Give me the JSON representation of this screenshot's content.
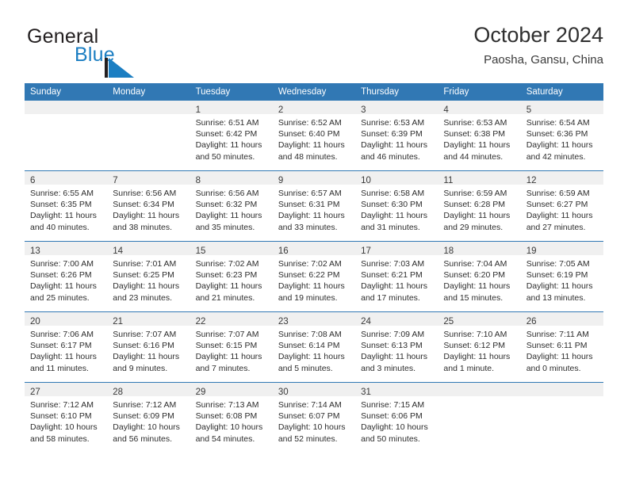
{
  "brand": {
    "name_part1": "General",
    "name_part2": "Blue",
    "mark_icon": "triangle-logo-icon",
    "accent_color": "#1b7ec2",
    "dark_color": "#231f20"
  },
  "header": {
    "title": "October 2024",
    "subtitle": "Paosha, Gansu, China"
  },
  "theme": {
    "header_bg": "#3178b4",
    "daynum_bg": "#f0f0f0",
    "row_divider": "#3178b4"
  },
  "weekday_headers": [
    "Sunday",
    "Monday",
    "Tuesday",
    "Wednesday",
    "Thursday",
    "Friday",
    "Saturday"
  ],
  "weeks": [
    [
      {
        "day": "",
        "sunrise": "",
        "sunset": "",
        "daylight_line1": "",
        "daylight_line2": "",
        "empty": true
      },
      {
        "day": "",
        "sunrise": "",
        "sunset": "",
        "daylight_line1": "",
        "daylight_line2": "",
        "empty": true
      },
      {
        "day": "1",
        "sunrise": "Sunrise: 6:51 AM",
        "sunset": "Sunset: 6:42 PM",
        "daylight_line1": "Daylight: 11 hours",
        "daylight_line2": "and 50 minutes."
      },
      {
        "day": "2",
        "sunrise": "Sunrise: 6:52 AM",
        "sunset": "Sunset: 6:40 PM",
        "daylight_line1": "Daylight: 11 hours",
        "daylight_line2": "and 48 minutes."
      },
      {
        "day": "3",
        "sunrise": "Sunrise: 6:53 AM",
        "sunset": "Sunset: 6:39 PM",
        "daylight_line1": "Daylight: 11 hours",
        "daylight_line2": "and 46 minutes."
      },
      {
        "day": "4",
        "sunrise": "Sunrise: 6:53 AM",
        "sunset": "Sunset: 6:38 PM",
        "daylight_line1": "Daylight: 11 hours",
        "daylight_line2": "and 44 minutes."
      },
      {
        "day": "5",
        "sunrise": "Sunrise: 6:54 AM",
        "sunset": "Sunset: 6:36 PM",
        "daylight_line1": "Daylight: 11 hours",
        "daylight_line2": "and 42 minutes."
      }
    ],
    [
      {
        "day": "6",
        "sunrise": "Sunrise: 6:55 AM",
        "sunset": "Sunset: 6:35 PM",
        "daylight_line1": "Daylight: 11 hours",
        "daylight_line2": "and 40 minutes."
      },
      {
        "day": "7",
        "sunrise": "Sunrise: 6:56 AM",
        "sunset": "Sunset: 6:34 PM",
        "daylight_line1": "Daylight: 11 hours",
        "daylight_line2": "and 38 minutes."
      },
      {
        "day": "8",
        "sunrise": "Sunrise: 6:56 AM",
        "sunset": "Sunset: 6:32 PM",
        "daylight_line1": "Daylight: 11 hours",
        "daylight_line2": "and 35 minutes."
      },
      {
        "day": "9",
        "sunrise": "Sunrise: 6:57 AM",
        "sunset": "Sunset: 6:31 PM",
        "daylight_line1": "Daylight: 11 hours",
        "daylight_line2": "and 33 minutes."
      },
      {
        "day": "10",
        "sunrise": "Sunrise: 6:58 AM",
        "sunset": "Sunset: 6:30 PM",
        "daylight_line1": "Daylight: 11 hours",
        "daylight_line2": "and 31 minutes."
      },
      {
        "day": "11",
        "sunrise": "Sunrise: 6:59 AM",
        "sunset": "Sunset: 6:28 PM",
        "daylight_line1": "Daylight: 11 hours",
        "daylight_line2": "and 29 minutes."
      },
      {
        "day": "12",
        "sunrise": "Sunrise: 6:59 AM",
        "sunset": "Sunset: 6:27 PM",
        "daylight_line1": "Daylight: 11 hours",
        "daylight_line2": "and 27 minutes."
      }
    ],
    [
      {
        "day": "13",
        "sunrise": "Sunrise: 7:00 AM",
        "sunset": "Sunset: 6:26 PM",
        "daylight_line1": "Daylight: 11 hours",
        "daylight_line2": "and 25 minutes."
      },
      {
        "day": "14",
        "sunrise": "Sunrise: 7:01 AM",
        "sunset": "Sunset: 6:25 PM",
        "daylight_line1": "Daylight: 11 hours",
        "daylight_line2": "and 23 minutes."
      },
      {
        "day": "15",
        "sunrise": "Sunrise: 7:02 AM",
        "sunset": "Sunset: 6:23 PM",
        "daylight_line1": "Daylight: 11 hours",
        "daylight_line2": "and 21 minutes."
      },
      {
        "day": "16",
        "sunrise": "Sunrise: 7:02 AM",
        "sunset": "Sunset: 6:22 PM",
        "daylight_line1": "Daylight: 11 hours",
        "daylight_line2": "and 19 minutes."
      },
      {
        "day": "17",
        "sunrise": "Sunrise: 7:03 AM",
        "sunset": "Sunset: 6:21 PM",
        "daylight_line1": "Daylight: 11 hours",
        "daylight_line2": "and 17 minutes."
      },
      {
        "day": "18",
        "sunrise": "Sunrise: 7:04 AM",
        "sunset": "Sunset: 6:20 PM",
        "daylight_line1": "Daylight: 11 hours",
        "daylight_line2": "and 15 minutes."
      },
      {
        "day": "19",
        "sunrise": "Sunrise: 7:05 AM",
        "sunset": "Sunset: 6:19 PM",
        "daylight_line1": "Daylight: 11 hours",
        "daylight_line2": "and 13 minutes."
      }
    ],
    [
      {
        "day": "20",
        "sunrise": "Sunrise: 7:06 AM",
        "sunset": "Sunset: 6:17 PM",
        "daylight_line1": "Daylight: 11 hours",
        "daylight_line2": "and 11 minutes."
      },
      {
        "day": "21",
        "sunrise": "Sunrise: 7:07 AM",
        "sunset": "Sunset: 6:16 PM",
        "daylight_line1": "Daylight: 11 hours",
        "daylight_line2": "and 9 minutes."
      },
      {
        "day": "22",
        "sunrise": "Sunrise: 7:07 AM",
        "sunset": "Sunset: 6:15 PM",
        "daylight_line1": "Daylight: 11 hours",
        "daylight_line2": "and 7 minutes."
      },
      {
        "day": "23",
        "sunrise": "Sunrise: 7:08 AM",
        "sunset": "Sunset: 6:14 PM",
        "daylight_line1": "Daylight: 11 hours",
        "daylight_line2": "and 5 minutes."
      },
      {
        "day": "24",
        "sunrise": "Sunrise: 7:09 AM",
        "sunset": "Sunset: 6:13 PM",
        "daylight_line1": "Daylight: 11 hours",
        "daylight_line2": "and 3 minutes."
      },
      {
        "day": "25",
        "sunrise": "Sunrise: 7:10 AM",
        "sunset": "Sunset: 6:12 PM",
        "daylight_line1": "Daylight: 11 hours",
        "daylight_line2": "and 1 minute."
      },
      {
        "day": "26",
        "sunrise": "Sunrise: 7:11 AM",
        "sunset": "Sunset: 6:11 PM",
        "daylight_line1": "Daylight: 11 hours",
        "daylight_line2": "and 0 minutes."
      }
    ],
    [
      {
        "day": "27",
        "sunrise": "Sunrise: 7:12 AM",
        "sunset": "Sunset: 6:10 PM",
        "daylight_line1": "Daylight: 10 hours",
        "daylight_line2": "and 58 minutes."
      },
      {
        "day": "28",
        "sunrise": "Sunrise: 7:12 AM",
        "sunset": "Sunset: 6:09 PM",
        "daylight_line1": "Daylight: 10 hours",
        "daylight_line2": "and 56 minutes."
      },
      {
        "day": "29",
        "sunrise": "Sunrise: 7:13 AM",
        "sunset": "Sunset: 6:08 PM",
        "daylight_line1": "Daylight: 10 hours",
        "daylight_line2": "and 54 minutes."
      },
      {
        "day": "30",
        "sunrise": "Sunrise: 7:14 AM",
        "sunset": "Sunset: 6:07 PM",
        "daylight_line1": "Daylight: 10 hours",
        "daylight_line2": "and 52 minutes."
      },
      {
        "day": "31",
        "sunrise": "Sunrise: 7:15 AM",
        "sunset": "Sunset: 6:06 PM",
        "daylight_line1": "Daylight: 10 hours",
        "daylight_line2": "and 50 minutes."
      },
      {
        "day": "",
        "sunrise": "",
        "sunset": "",
        "daylight_line1": "",
        "daylight_line2": "",
        "empty": true
      },
      {
        "day": "",
        "sunrise": "",
        "sunset": "",
        "daylight_line1": "",
        "daylight_line2": "",
        "empty": true
      }
    ]
  ]
}
